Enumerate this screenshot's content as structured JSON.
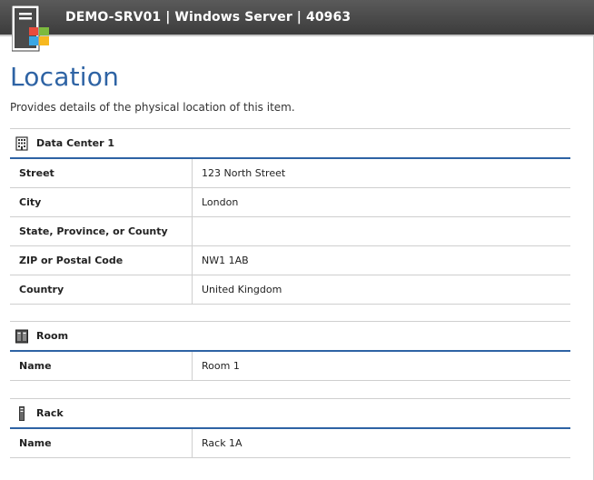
{
  "header": {
    "title": "DEMO-SRV01 | Windows Server | 40963",
    "icon": "windows-server-icon"
  },
  "page": {
    "title": "Location",
    "description": "Provides details of the physical location of this item."
  },
  "colors": {
    "accent": "#2e63a4",
    "topbar": "#474747",
    "divider": "#cfcfcf"
  },
  "sections": {
    "datacenter": {
      "title": "Data Center 1",
      "icon": "building-icon",
      "rows": [
        {
          "label": "Street",
          "value": "123 North Street"
        },
        {
          "label": "City",
          "value": "London"
        },
        {
          "label": "State, Province, or County",
          "value": ""
        },
        {
          "label": "ZIP or Postal Code",
          "value": "NW1 1AB"
        },
        {
          "label": "Country",
          "value": "United Kingdom"
        }
      ]
    },
    "room": {
      "title": "Room",
      "icon": "server-room-icon",
      "rows": [
        {
          "label": "Name",
          "value": "Room 1"
        }
      ]
    },
    "rack": {
      "title": "Rack",
      "icon": "rack-icon",
      "rows": [
        {
          "label": "Name",
          "value": "Rack 1A"
        }
      ]
    }
  }
}
